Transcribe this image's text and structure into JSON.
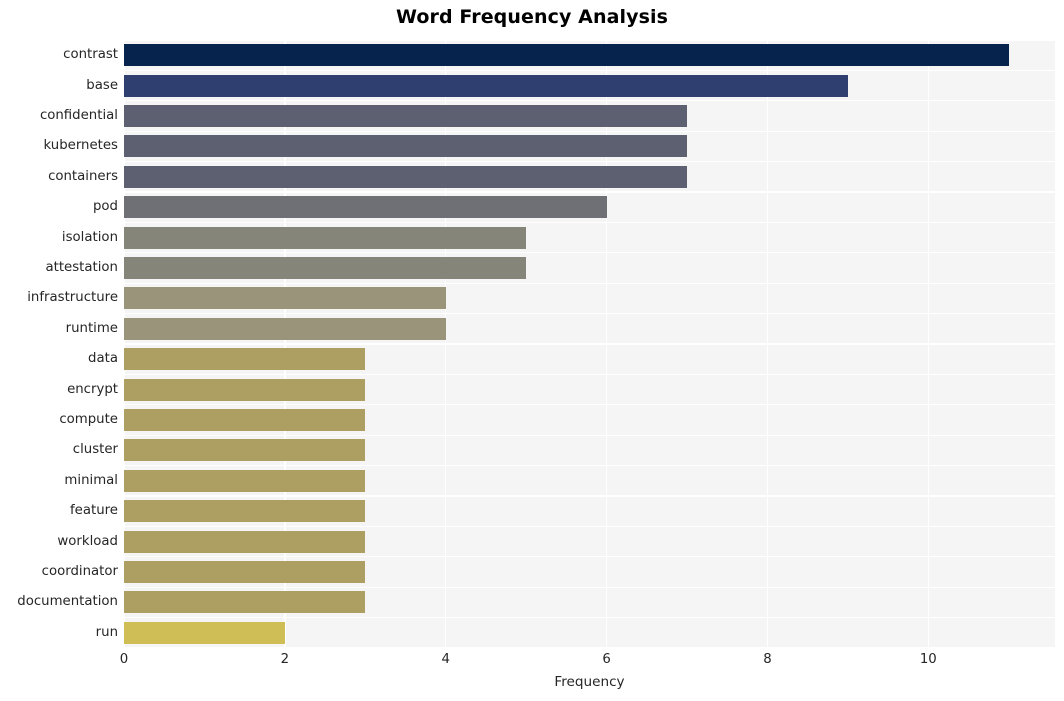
{
  "chart_data": {
    "type": "bar",
    "orientation": "horizontal",
    "title": "Word Frequency Analysis",
    "xlabel": "Frequency",
    "ylabel": "",
    "categories": [
      "contrast",
      "base",
      "confidential",
      "kubernetes",
      "containers",
      "pod",
      "isolation",
      "attestation",
      "infrastructure",
      "runtime",
      "data",
      "encrypt",
      "compute",
      "cluster",
      "minimal",
      "feature",
      "workload",
      "coordinator",
      "documentation",
      "run"
    ],
    "values": [
      11,
      9,
      7,
      7,
      7,
      6,
      5,
      5,
      4,
      4,
      3,
      3,
      3,
      3,
      3,
      3,
      3,
      3,
      3,
      2
    ],
    "bar_colors": [
      "#05234d",
      "#2f4070",
      "#5d6070",
      "#5d6070",
      "#5d6070",
      "#6e7075",
      "#85857a",
      "#85857a",
      "#99947a",
      "#99947a",
      "#ad9f62",
      "#ad9f62",
      "#ad9f62",
      "#ad9f62",
      "#ad9f62",
      "#ad9f62",
      "#ad9f62",
      "#ad9f62",
      "#ad9f62",
      "#cfbe56"
    ],
    "xticks": [
      0,
      2,
      4,
      6,
      8,
      10
    ],
    "xtick_labels": [
      "0",
      "2",
      "4",
      "6",
      "8",
      "10"
    ],
    "xlim": [
      0,
      11.575
    ],
    "grid": true,
    "grid_color": "#ffffff",
    "plot_background": "#f5f5f6",
    "figure_background": "#ffffff",
    "legend": null
  }
}
